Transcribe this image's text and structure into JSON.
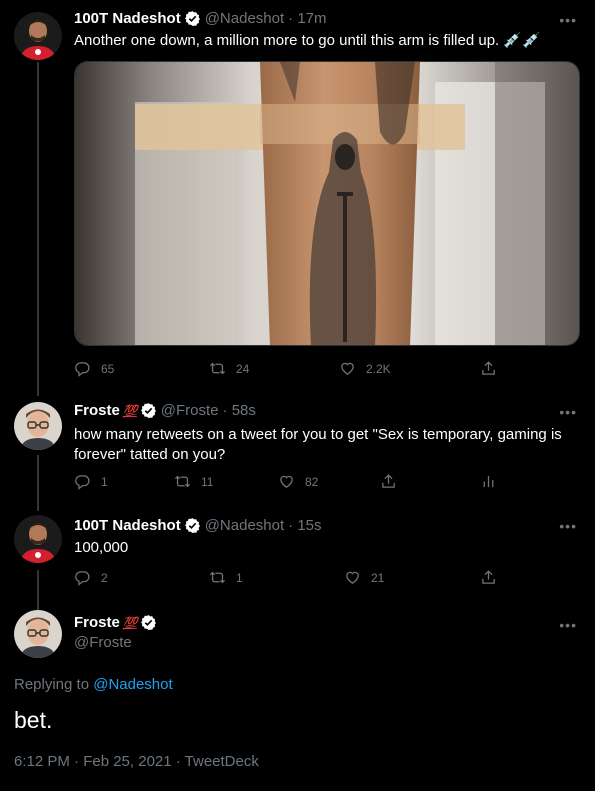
{
  "tweets": [
    {
      "name": "100T Nadeshot",
      "handle": "@Nadeshot",
      "time": "· 17m",
      "text": "Another one down, a million more to go until this arm is filled up. 💉💉",
      "stats": {
        "replies": "65",
        "retweets": "24",
        "likes": "2.2K"
      }
    },
    {
      "name": "Froste",
      "badge": "💯",
      "handle": "@Froste",
      "time": "· 58s",
      "text": "how many retweets on a tweet for you to get \"Sex is temporary, gaming is forever\" tatted on you?",
      "stats": {
        "replies": "1",
        "retweets": "11",
        "likes": "82"
      }
    },
    {
      "name": "100T Nadeshot",
      "handle": "@Nadeshot",
      "time": "· 15s",
      "text": "100,000",
      "stats": {
        "replies": "2",
        "retweets": "1",
        "likes": "21"
      }
    }
  ],
  "focus": {
    "name": "Froste",
    "badge": "💯",
    "handle": "@Froste",
    "replying_prefix": "Replying to",
    "replying_to": "@Nadeshot",
    "text": "bet.",
    "meta": "6:12 PM · Feb 25, 2021 · TweetDeck"
  },
  "more_label": "•••",
  "colors": {
    "background": "#000000",
    "accent": "#1da1f2",
    "muted": "#6e767d",
    "verified": "#ffffff"
  }
}
